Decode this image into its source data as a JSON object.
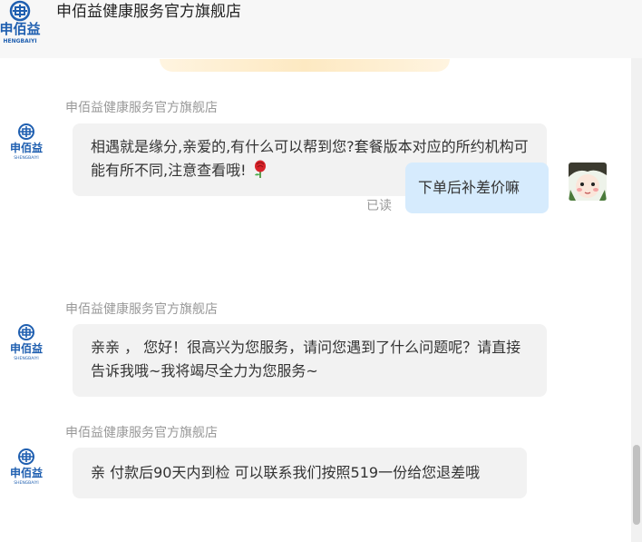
{
  "header": {
    "logo_text": "申佰益",
    "logo_sub": "HENGBAIYI",
    "title": "申佰益健康服务官方旗舰店"
  },
  "avatar_logo": {
    "text": "申佰益",
    "sub": "SHENGBAIYI"
  },
  "messages": [
    {
      "sender": "申佰益健康服务官方旗舰店",
      "text": "相遇就是缘分,亲爱的,有什么可以帮到您?套餐版本对应的所约机构可能有所不同,注意查看哦!",
      "icon": "rose-icon"
    },
    {
      "text": "下单后补差价嘛",
      "status": "已读"
    },
    {
      "sender": "申佰益健康服务官方旗舰店",
      "text": "亲亲 ， 您好！很高兴为您服务，请问您遇到了什么问题呢？请直接告诉我哦~我将竭尽全力为您服务~"
    },
    {
      "sender": "申佰益健康服务官方旗舰店",
      "text": "亲 付款后90天内到检 可以联系我们按照519一份给您退差哦"
    }
  ],
  "colors": {
    "brand": "#1f5fb0",
    "outgoing_bubble": "#d6ebfd",
    "incoming_bubble": "#f2f2f2"
  }
}
